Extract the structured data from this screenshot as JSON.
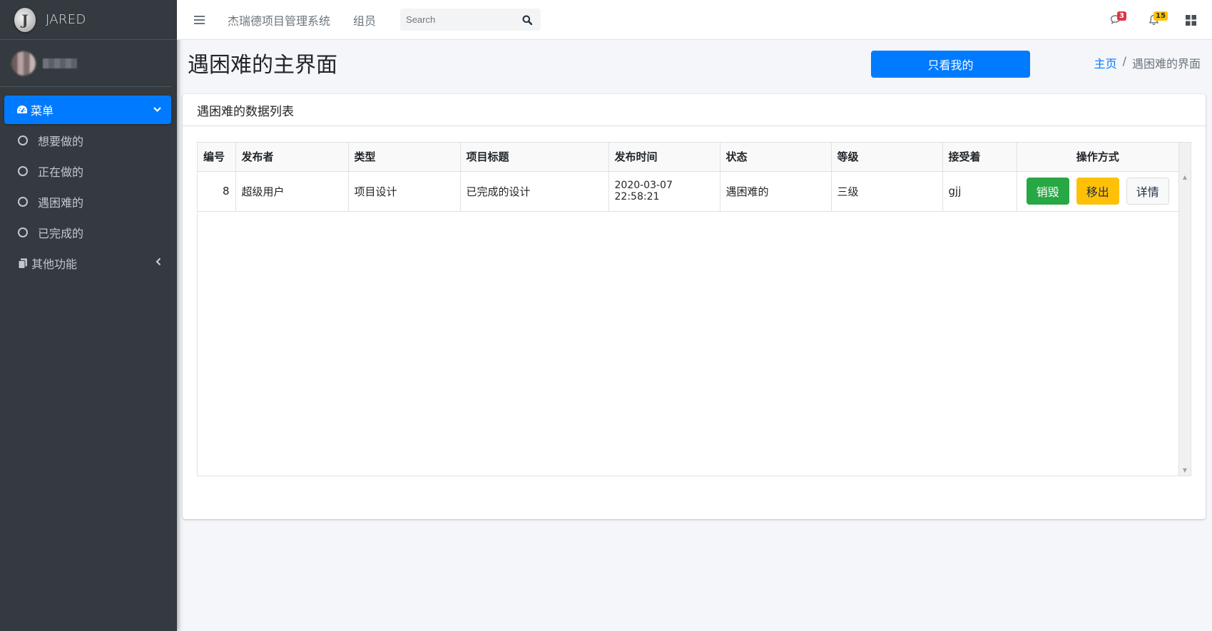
{
  "brand": {
    "logo_letter": "J",
    "name": "JARED"
  },
  "sidebar": {
    "menu_label": "菜单",
    "items": [
      {
        "label": "想要做的"
      },
      {
        "label": "正在做的"
      },
      {
        "label": "遇困难的"
      },
      {
        "label": "已完成的"
      }
    ],
    "other_label": "其他功能"
  },
  "topbar": {
    "system_link": "杰瑞德项目管理系统",
    "members_link": "组员",
    "search_placeholder": "Search",
    "messages_badge": "3",
    "notifications_badge": "15"
  },
  "header": {
    "title": "遇困难的主界面",
    "mine_button": "只看我的",
    "breadcrumb_home": "主页",
    "breadcrumb_sep": "/",
    "breadcrumb_current": "遇困难的界面"
  },
  "card": {
    "title": "遇困难的数据列表",
    "columns": [
      "编号",
      "发布者",
      "类型",
      "项目标题",
      "发布时间",
      "状态",
      "等级",
      "接受着",
      "操作方式"
    ],
    "rows": [
      {
        "id": "8",
        "publisher": "超级用户",
        "type": "项目设计",
        "title": "已完成的设计",
        "time": "2020-03-07 22:58:21",
        "status": "遇困难的",
        "level": "三级",
        "receiver": "gjj",
        "actions": {
          "destroy": "销毁",
          "remove": "移出",
          "detail": "详情"
        }
      }
    ]
  },
  "colors": {
    "primary": "#007bff",
    "success": "#28a745",
    "warning": "#ffc107",
    "sidebar": "#343a40"
  }
}
